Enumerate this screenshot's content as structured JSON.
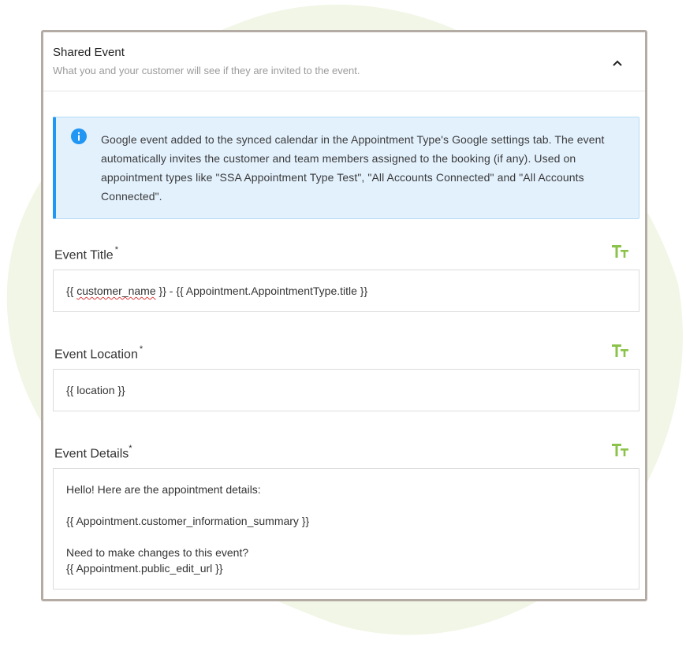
{
  "section": {
    "title": "Shared Event",
    "subtitle": "What you and your customer will see if they are invited to the event."
  },
  "info": {
    "text": "Google event added to the synced calendar in the Appointment Type's Google settings tab. The event automatically invites the customer and team members assigned to the booking (if any). Used on appointment types like \"SSA Appointment Type Test\", \"All Accounts Connected\" and \"All Accounts Connected\"."
  },
  "fields": {
    "title": {
      "label": "Event Title",
      "required_mark": "*",
      "value_prefix": "{{ ",
      "value_misspelled": "customer_name",
      "value_suffix": " }} - {{ Appointment.AppointmentType.title }}"
    },
    "location": {
      "label": "Event Location",
      "required_mark": "*",
      "value": "{{ location }}"
    },
    "details": {
      "label": "Event Details",
      "required_mark": "*",
      "lines": [
        "Hello! Here are the appointment details:",
        "{{ Appointment.customer_information_summary }}",
        "Need to make changes to this event?",
        "{{ Appointment.public_edit_url }}"
      ]
    }
  },
  "icons": {
    "collapse": "chevron-up-icon",
    "info": "info-circle-icon",
    "text_format": "text-size-icon"
  },
  "colors": {
    "info_accent": "#2196f3",
    "info_background": "#e3f1fd",
    "tt_icon": "#8bc34a",
    "card_border": "#b5aba5",
    "blob": "#f1f6e6"
  }
}
